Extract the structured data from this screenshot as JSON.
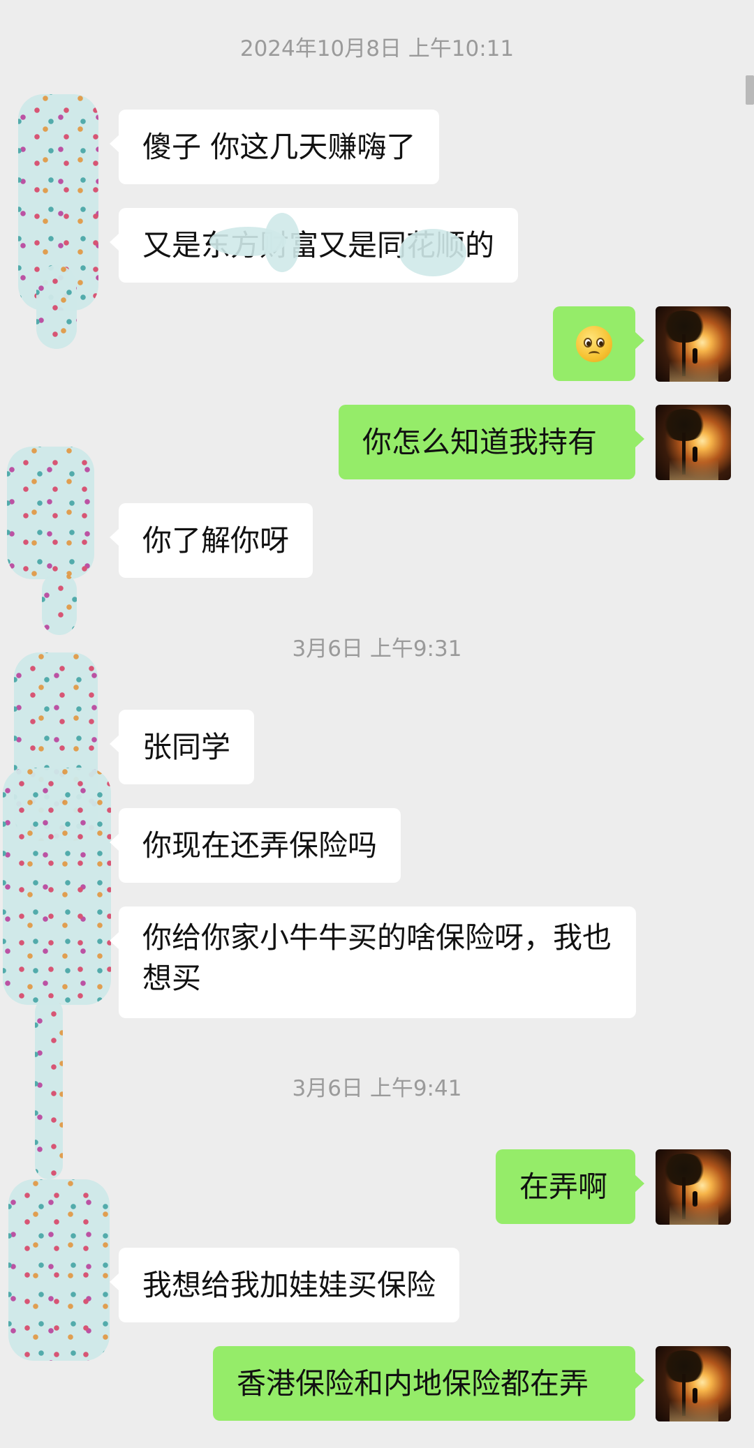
{
  "timestamps": [
    "2024年10月8日 上午10:11",
    "3月6日 上午9:31",
    "3月6日 上午9:41"
  ],
  "messages": [
    {
      "side": "in",
      "text": "傻子 你这几天赚嗨了"
    },
    {
      "side": "in",
      "text": "又是东方财富又是同花顺的"
    },
    {
      "side": "out",
      "emoji": "pleading-face-icon"
    },
    {
      "side": "out",
      "text": "你怎么知道我持有"
    },
    {
      "side": "in",
      "text": "你了解你呀"
    },
    {
      "side": "in",
      "text": "张同学"
    },
    {
      "side": "in",
      "text": "你现在还弄保险吗"
    },
    {
      "side": "in",
      "text": "你给你家小牛牛买的啥保险呀，我也想买"
    },
    {
      "side": "out",
      "text": "在弄啊"
    },
    {
      "side": "in",
      "text": "我想给我加娃娃买保险"
    },
    {
      "side": "out",
      "text": "香港保险和内地保险都在弄"
    }
  ],
  "colors": {
    "outgoing_bubble": "#95ec69",
    "incoming_bubble": "#ffffff",
    "background": "#ededed"
  }
}
